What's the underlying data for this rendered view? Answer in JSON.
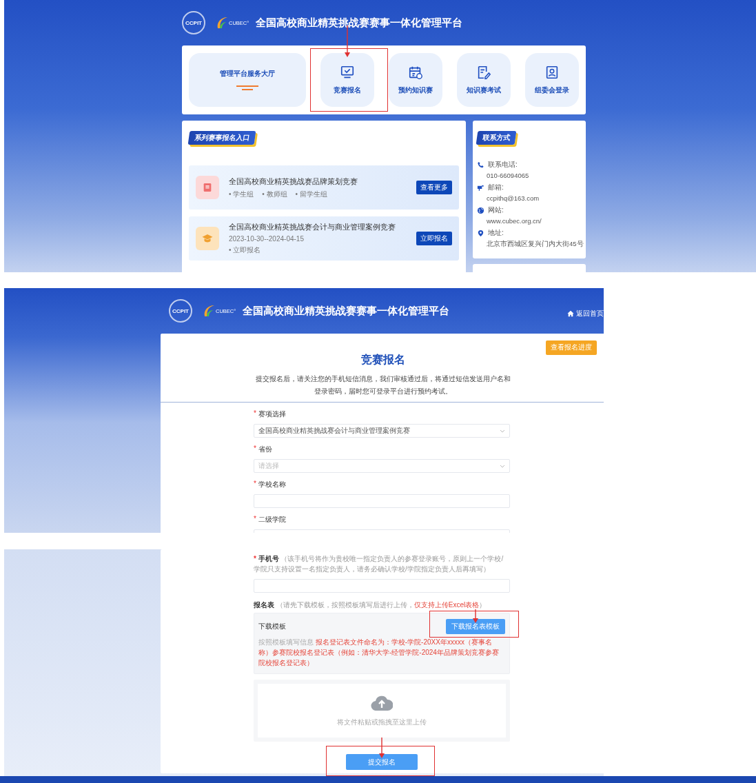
{
  "screen_1": {
    "header": {
      "logo_1": "CCPIT",
      "logo_2": "CUBEC°",
      "title": "全国高校商业精英挑战赛赛事一体化管理平台"
    },
    "nav": {
      "hall_title": "管理平台服务大厅",
      "items": [
        {
          "kind": "monitor",
          "label": "竞赛报名",
          "highlighted": true
        },
        {
          "kind": "calendar",
          "label": "预约知识赛",
          "highlighted": false
        },
        {
          "kind": "pen",
          "label": "知识赛考试",
          "highlighted": false
        },
        {
          "kind": "badge",
          "label": "组委会登录",
          "highlighted": false
        }
      ]
    },
    "series": {
      "heading": "系列赛事报名入口",
      "bullet": "•",
      "competitions": [
        {
          "kind": "book",
          "title": "全国高校商业精英挑战赛品牌策划竞赛",
          "tags": [
            "学生组",
            "教师组",
            "留学生组"
          ],
          "button": "查看更多"
        },
        {
          "kind": "cap",
          "title": "全国高校商业精英挑战赛会计与商业管理案例竞赛",
          "date": "2023-10-30--2024-04-15",
          "tags": [
            "立即报名"
          ],
          "button": "立即报名"
        }
      ]
    },
    "contact": {
      "heading": "联系方式",
      "entries": [
        {
          "kind": "phone",
          "label": "联系电话:",
          "value": "010-66094065"
        },
        {
          "kind": "mail",
          "label": "邮箱:",
          "value": "ccpithq@163.com"
        },
        {
          "kind": "globe",
          "label": "网站:",
          "value": "www.cubec.org.cn/"
        },
        {
          "kind": "pin",
          "label": "地址:",
          "value": "北京市西城区复兴门内大街45号"
        }
      ]
    }
  },
  "screen_2": {
    "header": {
      "logo_1": "CCPIT",
      "logo_2": "CUBEC°",
      "title": "全国高校商业精英挑战赛赛事一体化管理平台",
      "home_link": "返回首页"
    },
    "progress_button": "查看报名进度",
    "heading": "竞赛报名",
    "intro": "提交报名后，请关注您的手机短信消息，我们审核通过后，将通过短信发送用户名和登录密码，届时您可登录平台进行预约考试。",
    "fields": [
      {
        "mark": "*",
        "label": "赛项选择",
        "kind": "select",
        "value": "全国高校商业精英挑战赛会计与商业管理案例竞赛"
      },
      {
        "mark": "*",
        "label": "省份",
        "kind": "select",
        "placeholder": "请选择"
      },
      {
        "mark": "*",
        "label": "学校名称",
        "kind": "text"
      },
      {
        "mark": "*",
        "label": "二级学院",
        "kind": "text"
      }
    ]
  },
  "screen_3": {
    "phone_field": {
      "mark": "*",
      "label": "手机号",
      "hint": "（该手机号将作为贵校唯一指定负责人的参赛登录账号，原则上一个学校/学院只支持设置一名指定负责人，请务必确认学校/学院指定负责人后再填写）"
    },
    "form_upload": {
      "label": "报名表",
      "hint": "（请先下载模板，按照模板填写后进行上传，",
      "hint_red": "仅支持上传Excel表格",
      "hint_end": "）"
    },
    "template": {
      "title": "下载模板",
      "button": {
        "label": "下载报名表模板",
        "highlighted": true
      },
      "note": "按照模板填写信息",
      "note_red": "报名登记表文件命名为：学校-学院-20XX年xxxxx（赛事名称）参赛院校报名登记表（例如：清华大学-经管学院-2024年品牌策划竞赛参赛院校报名登记表）"
    },
    "upload_hint": "将文件粘贴或拖拽至这里上传",
    "submit": {
      "label": "提交报名",
      "highlighted": true
    }
  }
}
